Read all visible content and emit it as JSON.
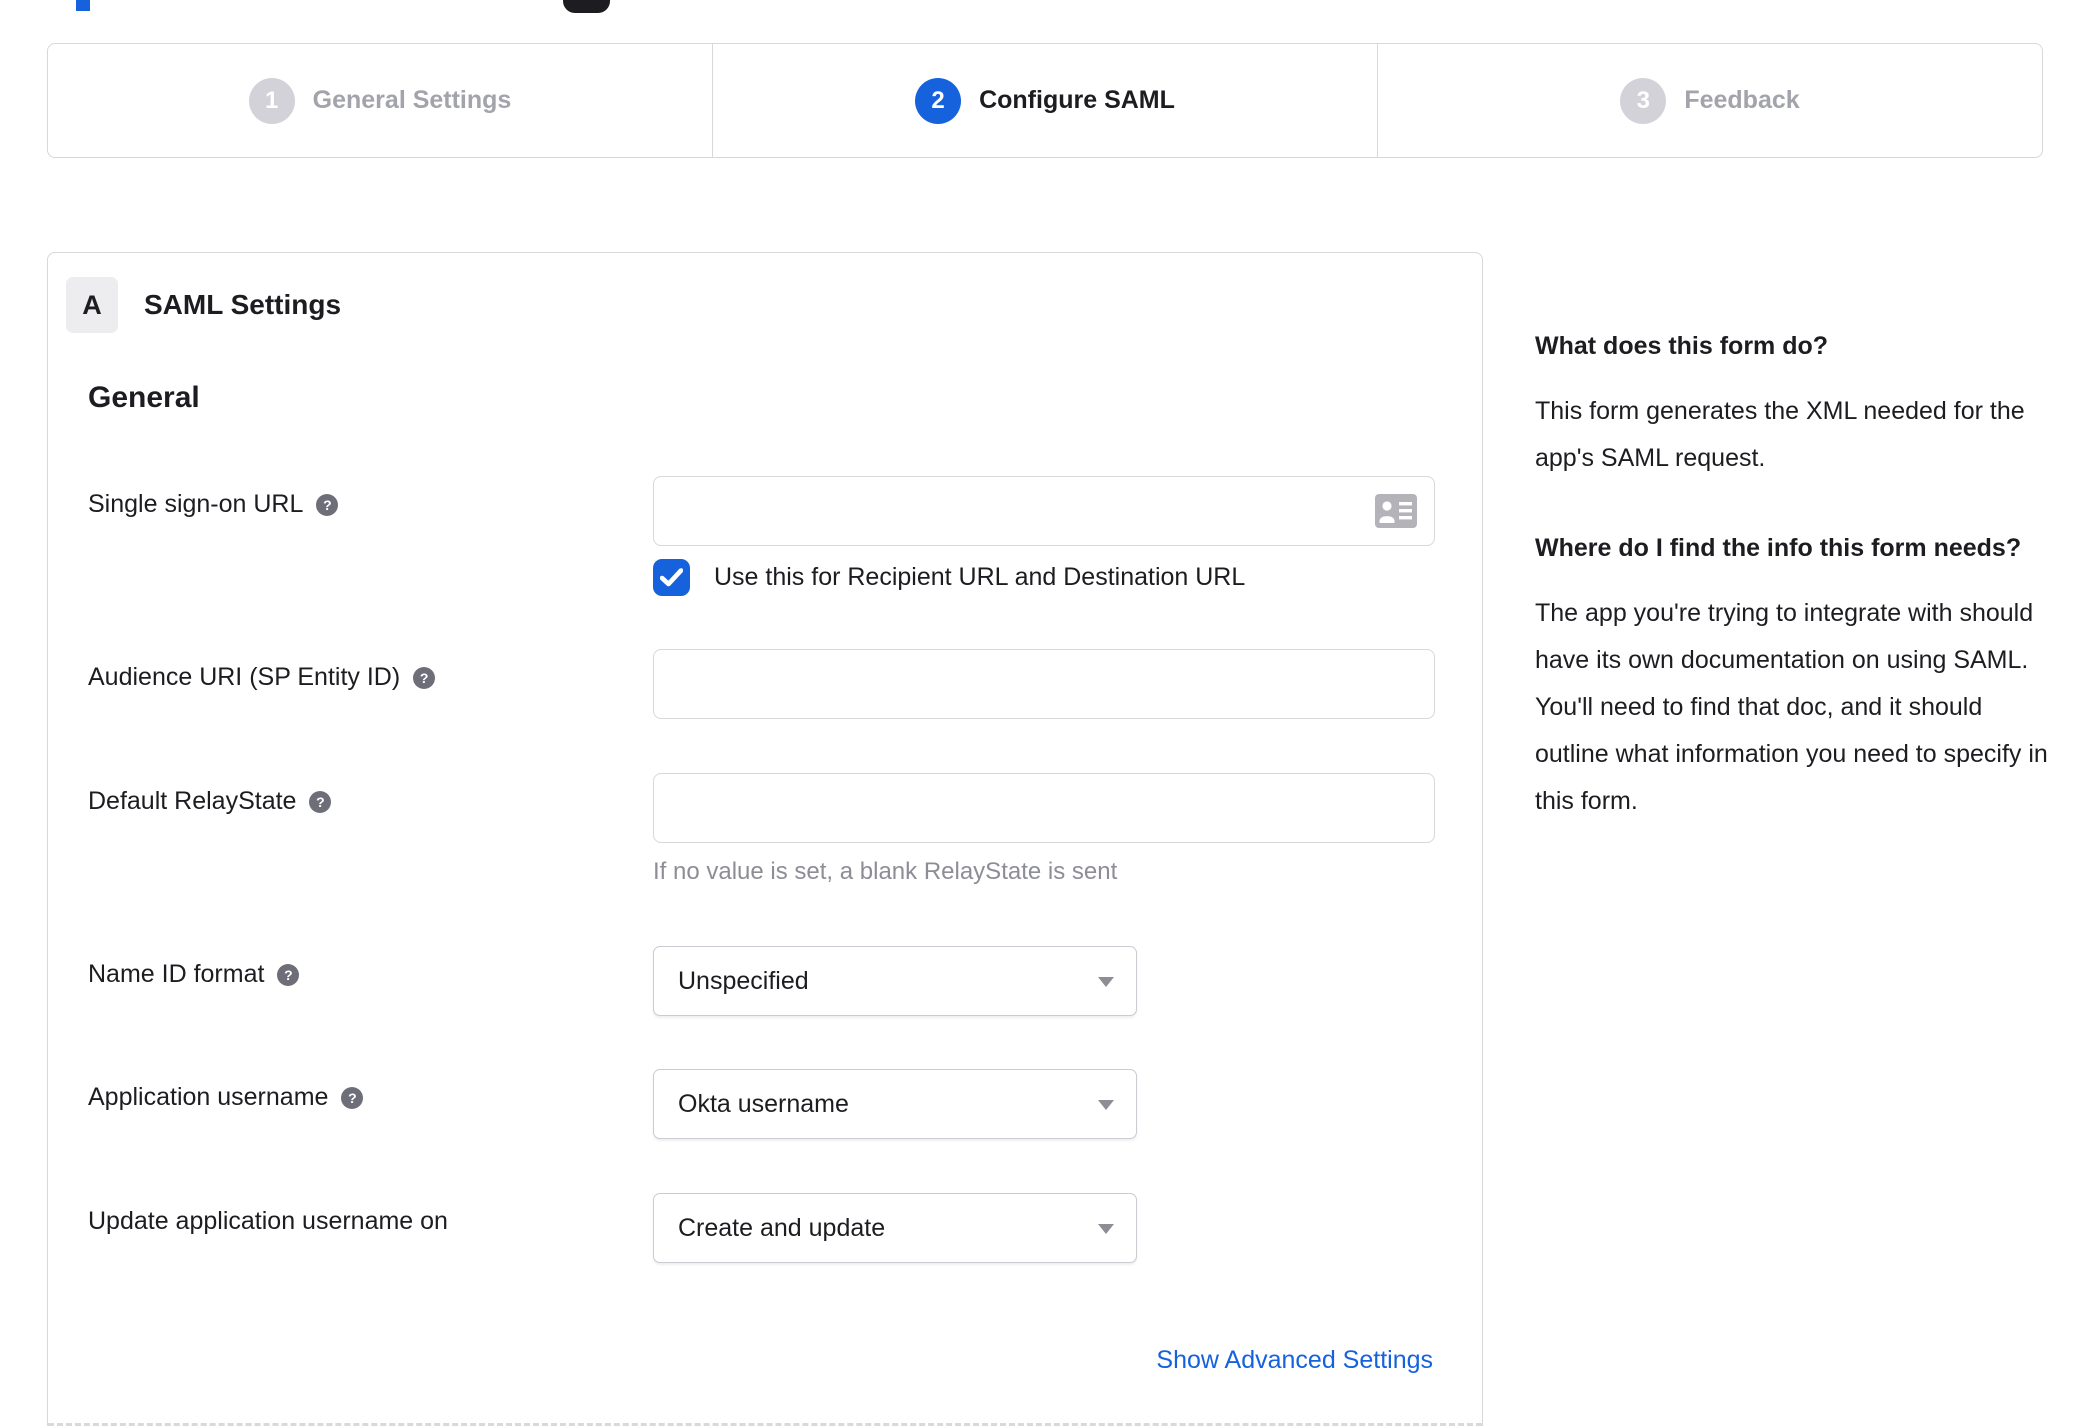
{
  "stepper": {
    "active_step": "2",
    "steps": [
      {
        "number": "1",
        "label": "General Settings"
      },
      {
        "number": "2",
        "label": "Configure SAML"
      },
      {
        "number": "3",
        "label": "Feedback"
      }
    ]
  },
  "panel": {
    "badge": "A",
    "title": "SAML Settings",
    "group_heading": "General",
    "sso_label": "Single sign-on URL",
    "sso_value": "",
    "sso_checkbox_label": "Use this for Recipient URL and Destination URL",
    "sso_checkbox_checked": true,
    "audience_label": "Audience URI (SP Entity ID)",
    "audience_value": "",
    "relaystate_label": "Default RelayState",
    "relaystate_value": "",
    "relaystate_helper": "If no value is set, a blank RelayState is sent",
    "nameid_label": "Name ID format",
    "nameid_value": "Unspecified",
    "appusername_label": "Application username",
    "appusername_value": "Okta username",
    "updateusername_label": "Update application username on",
    "updateusername_value": "Create and update",
    "advanced_link": "Show Advanced Settings"
  },
  "sidebar": {
    "heading1": "What does this form do?",
    "body1": "This form generates the XML needed for the app's SAML request.",
    "heading2": "Where do I find the info this form needs?",
    "body2": "The app you're trying to integrate with should have its own documentation on using SAML. You'll need to find that doc, and it should outline what information you need to specify in this form."
  },
  "colors": {
    "accent_blue": "#1662dd",
    "text_dark": "#1d1d21",
    "inactive_gray": "#a3a3ab",
    "border_gray": "#d7d7dc"
  }
}
